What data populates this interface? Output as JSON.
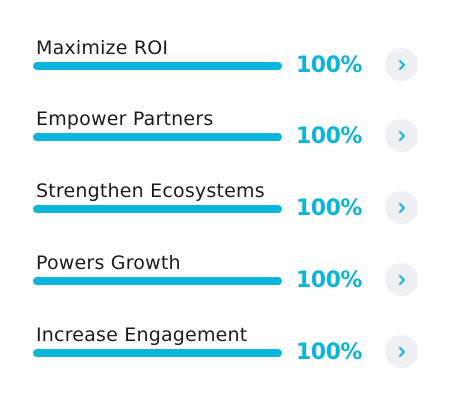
{
  "items": [
    {
      "label": "Maximize ROI",
      "percent_text": "100%",
      "progress": 1.0,
      "action_icon": "chevron-right-icon"
    },
    {
      "label": "Empower Partners",
      "percent_text": "100%",
      "progress": 1.0,
      "action_icon": "chevron-right-icon"
    },
    {
      "label": "Strengthen Ecosystems",
      "percent_text": "100%",
      "progress": 1.0,
      "action_icon": "chevron-right-icon"
    },
    {
      "label": "Powers Growth",
      "percent_text": "100%",
      "progress": 1.0,
      "action_icon": "chevron-right-icon"
    },
    {
      "label": "Increase Engagement",
      "percent_text": "100%",
      "progress": 1.0,
      "action_icon": "chevron-right-icon"
    }
  ],
  "colors": {
    "accent": "#0bb5dc",
    "label_text": "#1b1b1b",
    "button_bg": "#eef0f3"
  }
}
